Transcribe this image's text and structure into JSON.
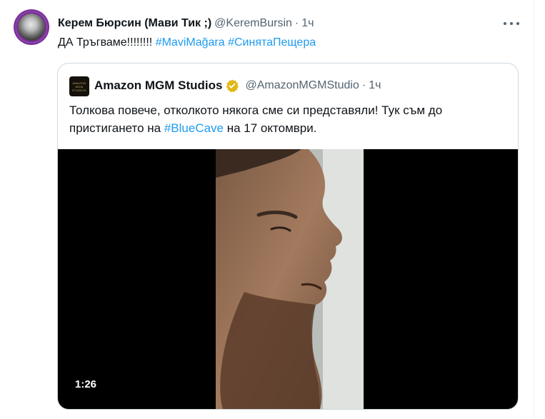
{
  "tweet": {
    "author_name": "Керем Бюрсин (Мави Тик ;)",
    "author_handle": "@KeremBursin",
    "separator": "·",
    "time": "1ч",
    "text_plain": "ДА Тръгваме!!!!!!!!",
    "hashtag_1": "#MaviMağara",
    "hashtag_2": "#СинятаПещера"
  },
  "quote": {
    "logo_lines": [
      "AMAZON",
      "MGM",
      "STUDIOS"
    ],
    "author_name": "Amazon MGM Studios",
    "author_handle": "@AmazonMGMStudio",
    "separator": "·",
    "time": "1ч",
    "text_line_1": "Толкова повече, отколкото някога сме си представяли! Тук съм до",
    "text_line_2_pre": "пристигането на ",
    "text_line_2_hashtag": "#BlueCave",
    "text_line_2_post": " на 17 октомври.",
    "video_duration": "1:26"
  },
  "colors": {
    "link": "#1d9bf0",
    "secondary_text": "#536471",
    "verified_gold": "#e2b719",
    "avatar_ring": "#7a2f9a"
  },
  "icons": {
    "more": "more-dots-icon",
    "verified": "verified-badge-icon"
  }
}
